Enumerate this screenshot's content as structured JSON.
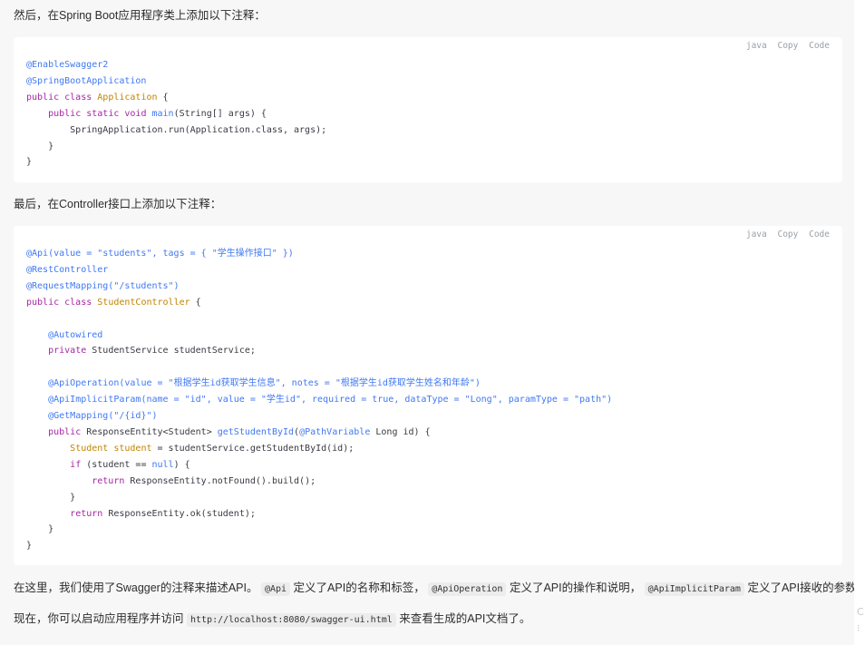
{
  "intro1": "然后，在Spring Boot应用程序类上添加以下注释：",
  "code1": {
    "lang": "java",
    "copy": "Copy",
    "code": "Code",
    "lines": [
      [
        [
          "ann",
          "@EnableSwagger2"
        ]
      ],
      [
        [
          "ann",
          "@SpringBootApplication"
        ]
      ],
      [
        [
          "kw",
          "public class "
        ],
        [
          "cls",
          "Application"
        ],
        [
          "plain",
          " {"
        ]
      ],
      [
        [
          "plain",
          "    "
        ],
        [
          "kw",
          "public static void "
        ],
        [
          "ann",
          "main"
        ],
        [
          "plain",
          "(String[] args) {"
        ]
      ],
      [
        [
          "plain",
          "        SpringApplication.run(Application.class, args);"
        ]
      ],
      [
        [
          "plain",
          "    }"
        ]
      ],
      [
        [
          "plain",
          "}"
        ]
      ]
    ]
  },
  "intro2": "最后，在Controller接口上添加以下注释：",
  "code2": {
    "lang": "java",
    "copy": "Copy",
    "code": "Code",
    "lines": [
      [
        [
          "ann",
          "@Api(value = \"students\", tags = { \"学生操作接口\" })"
        ]
      ],
      [
        [
          "ann",
          "@RestController"
        ]
      ],
      [
        [
          "ann",
          "@RequestMapping(\"/students\")"
        ]
      ],
      [
        [
          "kw",
          "public class "
        ],
        [
          "cls",
          "StudentController"
        ],
        [
          "plain",
          " {"
        ]
      ],
      [
        [
          "plain",
          ""
        ]
      ],
      [
        [
          "plain",
          "    "
        ],
        [
          "ann",
          "@Autowired"
        ]
      ],
      [
        [
          "plain",
          "    "
        ],
        [
          "kw",
          "private "
        ],
        [
          "plain",
          "StudentService studentService;"
        ]
      ],
      [
        [
          "plain",
          ""
        ]
      ],
      [
        [
          "plain",
          "    "
        ],
        [
          "ann",
          "@ApiOperation(value = \"根据学生id获取学生信息\", notes = \"根据学生id获取学生姓名和年龄\")"
        ]
      ],
      [
        [
          "plain",
          "    "
        ],
        [
          "ann",
          "@ApiImplicitParam(name = \"id\", value = \"学生id\", required = true, dataType = \"Long\", paramType = \"path\")"
        ]
      ],
      [
        [
          "plain",
          "    "
        ],
        [
          "ann",
          "@GetMapping(\"/{id}\")"
        ]
      ],
      [
        [
          "plain",
          "    "
        ],
        [
          "kw",
          "public "
        ],
        [
          "plain",
          "ResponseEntity<Student> "
        ],
        [
          "ann",
          "getStudentById"
        ],
        [
          "plain",
          "("
        ],
        [
          "ann",
          "@PathVariable"
        ],
        [
          "plain",
          " Long id) {"
        ]
      ],
      [
        [
          "plain",
          "        "
        ],
        [
          "cls",
          "Student student"
        ],
        [
          "plain",
          " = studentService.getStudentById(id);"
        ]
      ],
      [
        [
          "plain",
          "        "
        ],
        [
          "kw",
          "if "
        ],
        [
          "plain",
          "(student == "
        ],
        [
          "ann",
          "null"
        ],
        [
          "plain",
          ") {"
        ]
      ],
      [
        [
          "plain",
          "            "
        ],
        [
          "kw",
          "return "
        ],
        [
          "plain",
          "ResponseEntity.notFound().build();"
        ]
      ],
      [
        [
          "plain",
          "        }"
        ]
      ],
      [
        [
          "plain",
          "        "
        ],
        [
          "kw",
          "return "
        ],
        [
          "plain",
          "ResponseEntity.ok(student);"
        ]
      ],
      [
        [
          "plain",
          "    }"
        ]
      ],
      [
        [
          "plain",
          "}"
        ]
      ]
    ]
  },
  "outro1": {
    "p1": "在这里，我们使用了Swagger的注释来描述API。",
    "c1": "@Api",
    "p2": "定义了API的名称和标签，",
    "c2": "@ApiOperation",
    "p3": "定义了API的操作和说明，",
    "c3": "@ApiImplicitParam",
    "p4": "定义了API接收的参数。"
  },
  "outro2": {
    "p1": "现在，你可以启动应用程序并访问",
    "c1": "http://localhost:8080/swagger-ui.html",
    "p2": "来查看生成的API文档了。"
  },
  "scroll_glyphs": [
    "C",
    "⁝"
  ]
}
